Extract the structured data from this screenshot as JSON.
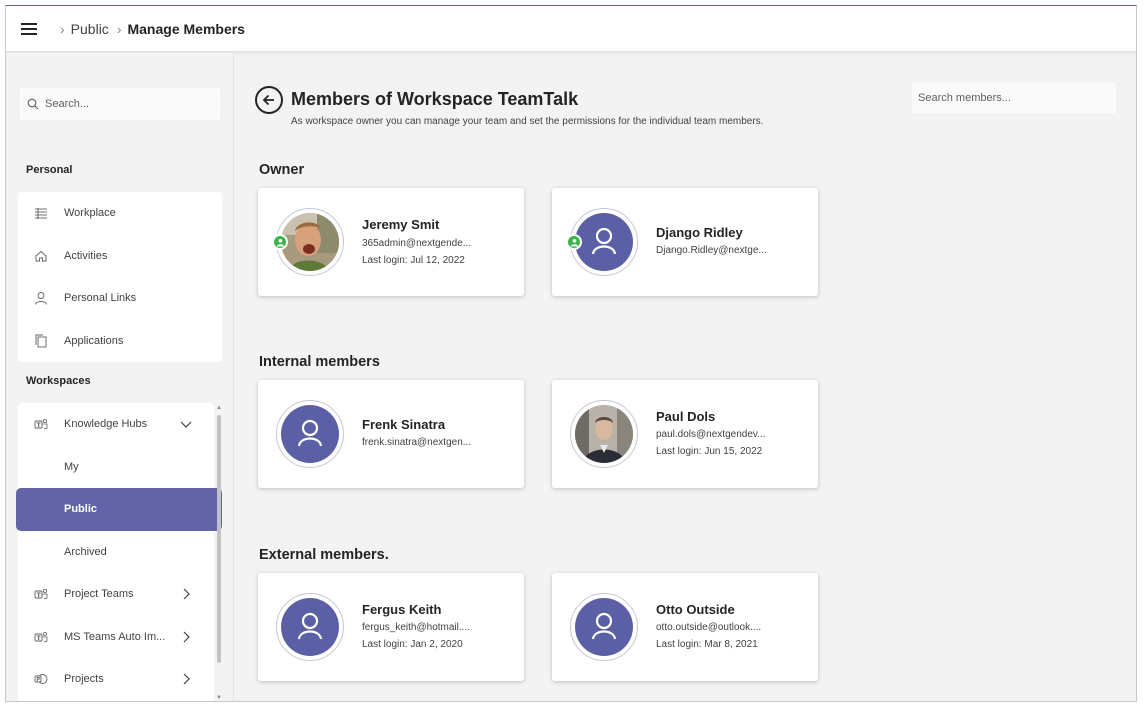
{
  "breadcrumb": {
    "items": [
      "Public",
      "Manage Members"
    ]
  },
  "sidebar": {
    "search_placeholder": "Search...",
    "personal_heading": "Personal",
    "personal_items": [
      {
        "label": "Workplace",
        "icon": "grid-list-icon"
      },
      {
        "label": "Activities",
        "icon": "home-icon"
      },
      {
        "label": "Personal Links",
        "icon": "person-icon"
      },
      {
        "label": "Applications",
        "icon": "copy-icon"
      }
    ],
    "workspaces_heading": "Workspaces",
    "workspace_items": [
      {
        "label": "Knowledge Hubs",
        "icon": "teams-icon",
        "expanded": true,
        "children": [
          "My",
          "Public",
          "Archived"
        ]
      },
      {
        "label": "Project Teams",
        "icon": "teams-icon"
      },
      {
        "label": "MS Teams Auto Im...",
        "icon": "teams-icon"
      },
      {
        "label": "Projects",
        "icon": "project-icon"
      }
    ],
    "active_item": "Public"
  },
  "main": {
    "title": "Members of Workspace TeamTalk",
    "subtitle": "As workspace owner you can manage your team and set the permissions for the individual team members.",
    "search_placeholder": "Search members...",
    "sections": {
      "owner": {
        "title": "Owner",
        "members": [
          {
            "name": "Jeremy Smit",
            "email": "365admin@nextgende...",
            "last_login": "Last login: Jul 12, 2022",
            "avatar": "photo",
            "owner": true
          },
          {
            "name": "Django Ridley",
            "email": "Django.Ridley@nextge...",
            "last_login": "",
            "avatar": "placeholder",
            "owner": true
          }
        ]
      },
      "internal": {
        "title": "Internal members",
        "members": [
          {
            "name": "Frenk Sinatra",
            "email": "frenk.sinatra@nextgen...",
            "last_login": "",
            "avatar": "placeholder"
          },
          {
            "name": "Paul Dols",
            "email": "paul.dols@nextgendev...",
            "last_login": "Last login: Jun 15, 2022",
            "avatar": "photo"
          }
        ]
      },
      "external": {
        "title": "External members.",
        "members": [
          {
            "name": "Fergus Keith",
            "email": "fergus_keith@hotmail....",
            "last_login": "Last login: Jan 2, 2020",
            "avatar": "placeholder"
          },
          {
            "name": "Otto Outside",
            "email": "otto.outside@outlook....",
            "last_login": "Last login: Mar 8, 2021",
            "avatar": "placeholder"
          }
        ]
      }
    }
  },
  "colors": {
    "accent": "#6264a7",
    "avatar_placeholder": "#5b5fa5",
    "owner_badge": "#39b54a"
  }
}
